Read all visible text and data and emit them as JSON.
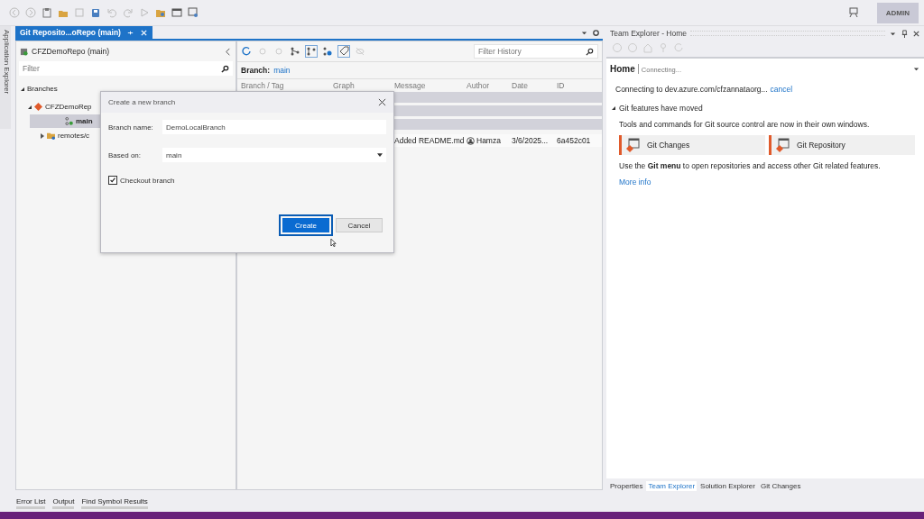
{
  "toolbar": {
    "account": "ADMIN"
  },
  "side_strip": {
    "label": "Application Explorer"
  },
  "document_tab": {
    "title": "Git Reposito...oRepo (main)",
    "selected": true
  },
  "repo_pane": {
    "title": "CFZDemoRepo (main)",
    "filter_placeholder": "Filter",
    "section": "Branches",
    "section_expanded": true,
    "tree": [
      {
        "label": "CFZDemoRep",
        "expanded": true,
        "selected": false,
        "children": [
          {
            "label": "main",
            "selected": true
          },
          {
            "label": "remotes/c",
            "selected": false,
            "expanded": false
          }
        ]
      }
    ]
  },
  "history": {
    "filter_placeholder": "Filter History",
    "branch_label": "Branch:",
    "branch": "main",
    "columns": [
      "Branch / Tag",
      "Graph",
      "Message",
      "Author",
      "Date",
      "ID"
    ],
    "rows": [
      {
        "kind": "group"
      },
      {
        "kind": "group"
      },
      {
        "kind": "group"
      },
      {
        "kind": "commit",
        "message": "Added README.md",
        "author": "Hamza",
        "date": "3/6/2025...",
        "id": "6a452c01"
      }
    ]
  },
  "dialog": {
    "title": "Create a new branch",
    "branch_name_label": "Branch name:",
    "branch_name": "DemoLocalBranch",
    "based_on_label": "Based on:",
    "based_on": "main",
    "checkout_label": "Checkout branch",
    "checkout": true,
    "buttons": [
      {
        "label": "Create",
        "primary": true,
        "focused": true
      },
      {
        "label": "Cancel",
        "primary": false,
        "focused": false
      }
    ]
  },
  "team_explorer": {
    "title": "Team Explorer - Home",
    "heading": "Home",
    "status": "Connecting...",
    "connecting": "Connecting to dev.azure.com/cfzannataorg...",
    "cancel": "cancel",
    "section": "Git features have moved",
    "section_expanded": true,
    "description": "Tools and commands for Git source control are now in their own windows.",
    "tiles": [
      "Git Changes",
      "Git Repository"
    ],
    "note": "Use the **Git menu** to open repositories and access other Git related features.",
    "more_info": "More info",
    "tabs": [
      {
        "label": "Properties",
        "selected": false
      },
      {
        "label": "Team Explorer",
        "selected": true
      },
      {
        "label": "Solution Explorer",
        "selected": false
      },
      {
        "label": "Git Changes",
        "selected": false
      }
    ]
  },
  "bottom_tabs": [
    "Error List",
    "Output",
    "Find Symbol Results"
  ]
}
